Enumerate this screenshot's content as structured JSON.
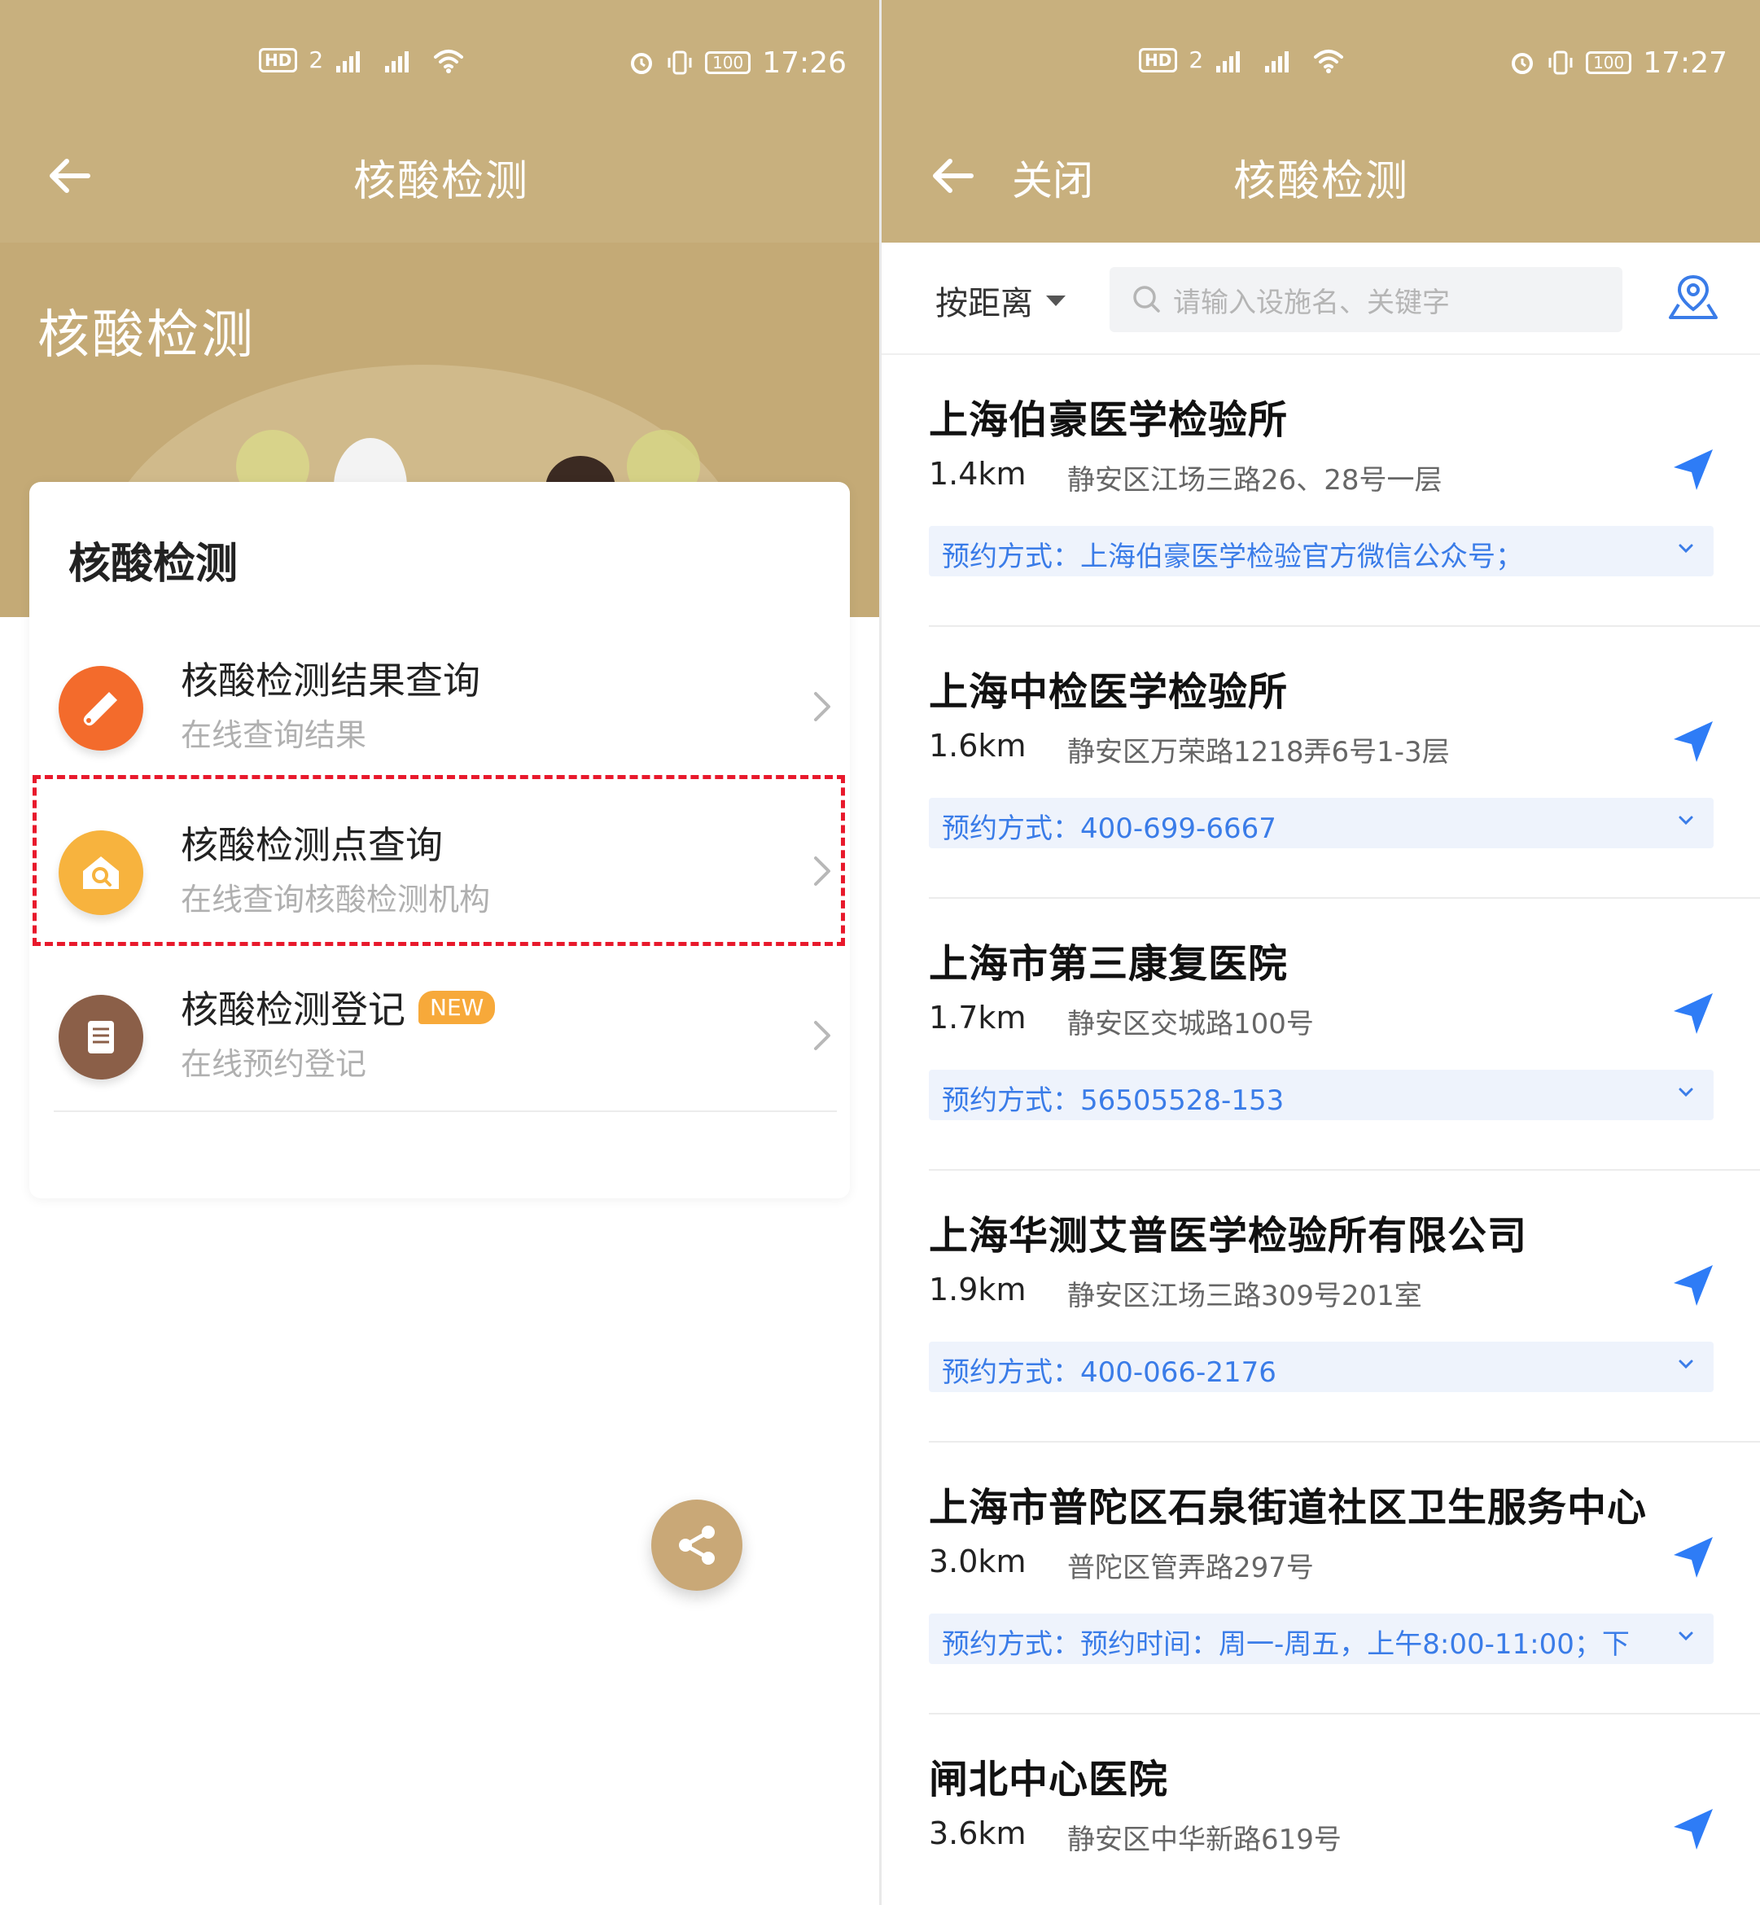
{
  "left": {
    "status": {
      "time": "17:26",
      "battery": "100"
    },
    "header": {
      "title": "核酸检测"
    },
    "hero": {
      "title": "核酸检测"
    },
    "card": {
      "title": "核酸检测",
      "items": [
        {
          "label": "核酸检测结果查询",
          "sub": "在线查询结果",
          "icon": "test-tube-icon",
          "color": "#f36b2c"
        },
        {
          "label": "核酸检测点查询",
          "sub": "在线查询核酸检测机构",
          "icon": "home-search-icon",
          "color": "#f7b33e"
        },
        {
          "label": "核酸检测登记",
          "sub": "在线预约登记",
          "icon": "document-icon",
          "color": "#8b5f48",
          "badge": "NEW"
        }
      ]
    }
  },
  "right": {
    "status": {
      "time": "17:27",
      "battery": "100"
    },
    "header": {
      "close": "关闭",
      "title": "核酸检测"
    },
    "filter": {
      "sort": "按距离",
      "search_placeholder": "请输入设施名、关键字"
    },
    "list": [
      {
        "name": "上海伯豪医学检验所",
        "distance": "1.4km",
        "address": "静安区江场三路26、28号一层",
        "appt": "预约方式：上海伯豪医学检验官方微信公众号；"
      },
      {
        "name": "上海中检医学检验所",
        "distance": "1.6km",
        "address": "静安区万荣路1218弄6号1-3层",
        "appt": "预约方式：400-699-6667"
      },
      {
        "name": "上海市第三康复医院",
        "distance": "1.7km",
        "address": "静安区交城路100号",
        "appt": "预约方式：56505528-153"
      },
      {
        "name": "上海华测艾普医学检验所有限公司",
        "distance": "1.9km",
        "address": "静安区江场三路309号201室",
        "appt": "预约方式：400-066-2176"
      },
      {
        "name": "上海市普陀区石泉街道社区卫生服务中心",
        "distance": "3.0km",
        "address": "普陀区管弄路297号",
        "appt": "预约方式：预约时间：周一-周五，上午8:00-11:00；下"
      },
      {
        "name": "闸北中心医院",
        "distance": "3.6km",
        "address": "静安区中华新路619号",
        "appt": ""
      }
    ]
  },
  "colors": {
    "header": "#c8b07e",
    "accent_blue": "#3a7ce8",
    "highlight": "#e8192c",
    "badge": "#f7a93a"
  }
}
